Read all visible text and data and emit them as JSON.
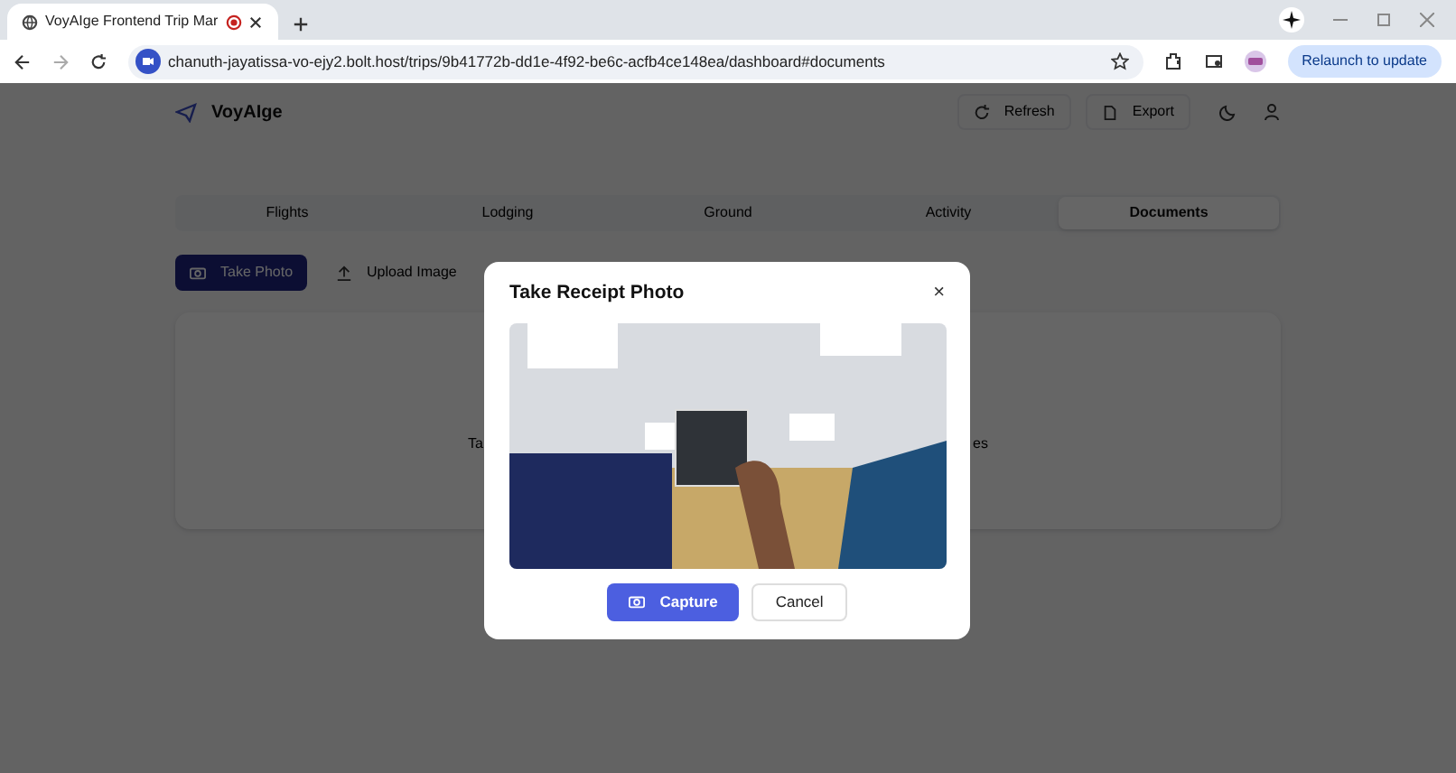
{
  "browser": {
    "tab_title": "VoyAIge Frontend Trip Mar",
    "url": "chanuth-jayatissa-vo-ejy2.bolt.host/trips/9b41772b-dd1e-4f92-be6c-acfb4ce148ea/dashboard#documents",
    "update_button": "Relaunch to update"
  },
  "app": {
    "logo": "VoyAIge",
    "header_buttons": [
      "Refresh",
      "Export"
    ],
    "tabs": [
      {
        "label": "Flights",
        "selected": false
      },
      {
        "label": "Lodging",
        "selected": false
      },
      {
        "label": "Ground",
        "selected": false
      },
      {
        "label": "Activity",
        "selected": false
      },
      {
        "label": "Documents",
        "selected": true
      }
    ],
    "actions": [
      "Take Photo",
      "Upload Image"
    ],
    "empty_text_left": "Ta",
    "empty_text_right": "es"
  },
  "dialog": {
    "title": "Take Receipt Photo",
    "close": "×",
    "buttons": [
      "Capture",
      "Cancel"
    ]
  }
}
